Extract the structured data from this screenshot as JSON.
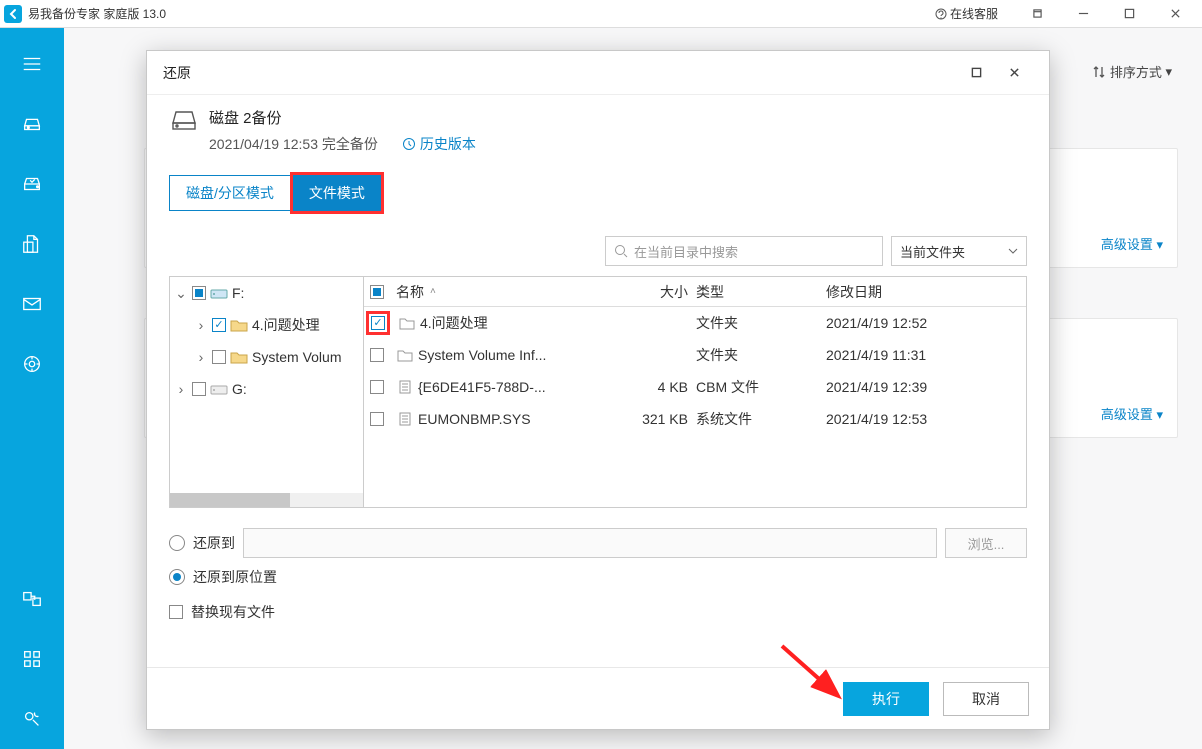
{
  "titlebar": {
    "app_title": "易我备份专家 家庭版 13.0",
    "support": "在线客服"
  },
  "content": {
    "sort_label": "排序方式",
    "adv_settings": "高级设置"
  },
  "dialog": {
    "title": "还原",
    "header": {
      "title": "磁盘 2备份",
      "subtitle": "2021/04/19 12:53 完全备份",
      "history": "历史版本"
    },
    "tabs": {
      "disk": "磁盘/分区模式",
      "file": "文件模式"
    },
    "search": {
      "placeholder": "在当前目录中搜索",
      "scope": "当前文件夹"
    },
    "tree": {
      "root": "F:",
      "children": [
        {
          "label": "4.问题处理",
          "checked": true
        },
        {
          "label": "System Volum"
        }
      ],
      "g": "G:"
    },
    "columns": {
      "name": "名称",
      "size": "大小",
      "type": "类型",
      "date": "修改日期"
    },
    "rows": [
      {
        "name": "4.问题处理",
        "size": "",
        "type": "文件夹",
        "date": "2021/4/19 12:52",
        "checked": true,
        "icon": "folder"
      },
      {
        "name": "System Volume Inf...",
        "size": "",
        "type": "文件夹",
        "date": "2021/4/19 11:31",
        "icon": "folder"
      },
      {
        "name": "{E6DE41F5-788D-...",
        "size": "4 KB",
        "type": "CBM 文件",
        "date": "2021/4/19 12:39",
        "icon": "file"
      },
      {
        "name": "EUMONBMP.SYS",
        "size": "321 KB",
        "type": "系统文件",
        "date": "2021/4/19 12:53",
        "icon": "file"
      }
    ],
    "dest": {
      "to": "还原到",
      "orig": "还原到原位置",
      "overwrite": "替换现有文件",
      "browse": "浏览..."
    },
    "buttons": {
      "execute": "执行",
      "cancel": "取消"
    }
  }
}
